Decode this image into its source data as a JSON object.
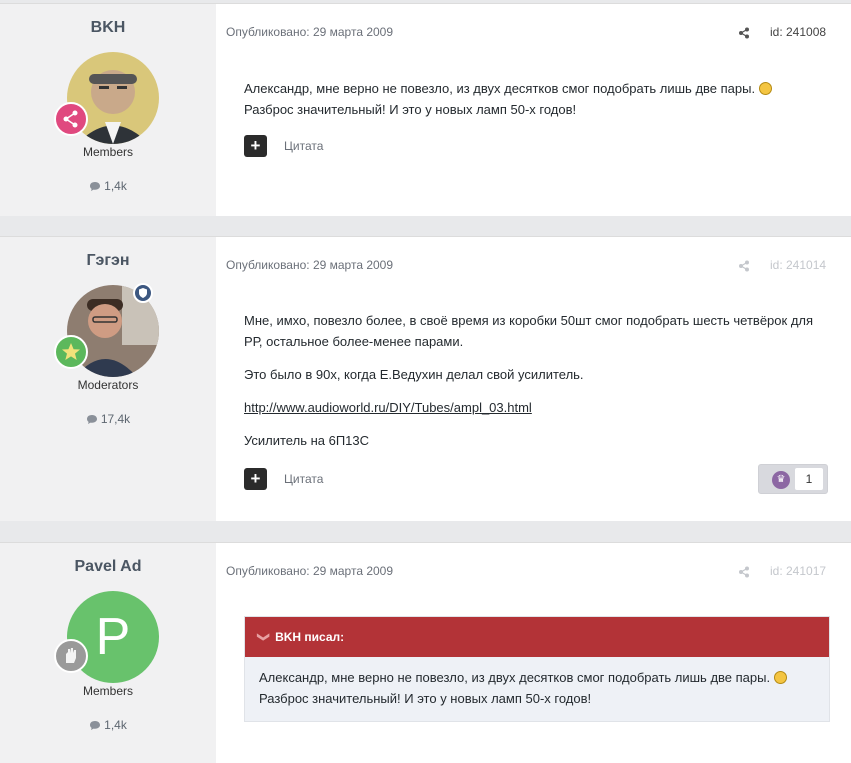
{
  "posts": [
    {
      "author": "BKH",
      "group": "Members",
      "count": "1,4k",
      "published": "Опубликовано: 29 марта 2009",
      "id": "id: 241008",
      "content": [
        "Александр, мне верно не повезло, из двух десятков смог подобрать лишь две пары.",
        "Разброс значительный! И это у новых ламп 50-х годов!"
      ],
      "quote_label": "Цитата"
    },
    {
      "author": "Гэгэн",
      "group": "Moderators",
      "count": "17,4k",
      "published": "Опубликовано: 29 марта 2009",
      "id": "id: 241014",
      "content": [
        "Мне, имхо, повезло более, в своё время из коробки 50шт смог подобрать шесть четвёрок для РР, остальное более-менее парами.",
        "Это было в 90х, когда Е.Ведухин делал свой усилитель.",
        "http://www.audioworld.ru/DIY/Tubes/ampl_03.html",
        "Усилитель на 6П13С"
      ],
      "quote_label": "Цитата",
      "reaction_count": "1"
    },
    {
      "author": "Pavel Ad",
      "avatar_letter": "P",
      "group": "Members",
      "count": "1,4k",
      "published": "Опубликовано: 29 марта 2009",
      "id": "id: 241017",
      "quote_header": "BKH писал:",
      "quote_body": [
        "Александр, мне верно не повезло, из двух десятков смог подобрать лишь две пары.",
        "Разброс значительный! И это у новых ламп 50-х годов!"
      ]
    }
  ],
  "colors": {
    "accent_red": "#b33337",
    "avatar_green": "#68c26c",
    "rank_pink": "#e0497f",
    "rank_green": "#5cb85c"
  },
  "icons": [
    "share-icon",
    "plus-icon",
    "speech-bubble-icon",
    "rank-badge-icon",
    "trophy-icon",
    "chevron-down-icon",
    "sad-emoji-icon"
  ]
}
